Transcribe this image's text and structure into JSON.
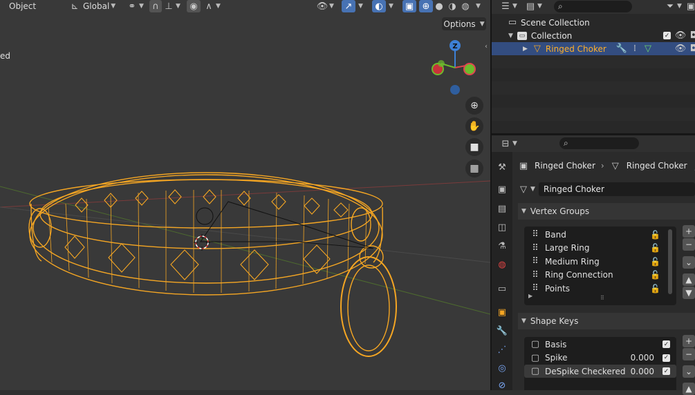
{
  "viewport": {
    "header": {
      "mode_label": "Object",
      "orientation_label": "Global"
    },
    "options_label": "Options",
    "partial_text": "ed",
    "gizmo": {
      "z_label": "Z"
    },
    "colors": {
      "wire": "#f5a623",
      "axis_x": "#e0454f",
      "axis_y": "#6dbb2c",
      "axis_z": "#3d80d6"
    }
  },
  "outliner": {
    "scene_collection": "Scene Collection",
    "collection": "Collection",
    "object": "Ringed Choker",
    "search_placeholder": ""
  },
  "properties": {
    "breadcrumb": {
      "object": "Ringed Choker",
      "data": "Ringed Choker"
    },
    "mesh_name": "Ringed Choker",
    "vertex_groups": {
      "title": "Vertex Groups",
      "items": [
        "Band",
        "Large Ring",
        "Medium Ring",
        "Ring Connection",
        "Points"
      ]
    },
    "shape_keys": {
      "title": "Shape Keys",
      "items": [
        {
          "name": "Basis",
          "value": ""
        },
        {
          "name": "Spike",
          "value": "0.000"
        },
        {
          "name": "DeSpike Checkered",
          "value": "0.000"
        }
      ]
    }
  }
}
